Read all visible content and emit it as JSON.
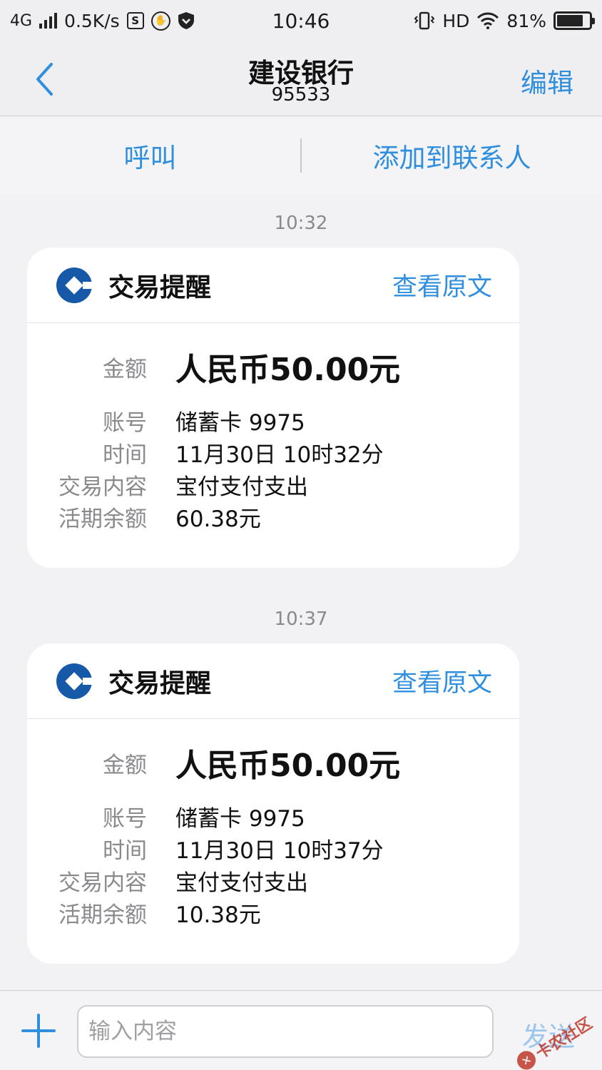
{
  "status_bar": {
    "network": "4G",
    "speed": "0.5K/s",
    "time": "10:46",
    "hd": "HD",
    "battery": "81%",
    "battery_level": 0.81,
    "icons": [
      "signal-icon",
      "s-box-icon",
      "hand-circle-icon",
      "shield-icon",
      "vibrate-icon",
      "wifi-icon",
      "battery-icon"
    ]
  },
  "header": {
    "title": "建设银行",
    "subtitle": "95533",
    "edit_label": "编辑",
    "back_icon": "chevron-left-icon"
  },
  "actions": {
    "call_label": "呼叫",
    "add_contact_label": "添加到联系人"
  },
  "messages": [
    {
      "time": "10:32",
      "title": "交易提醒",
      "view_label": "查看原文",
      "amount_label": "金额",
      "amount": "人民币50.00元",
      "fields": [
        {
          "label": "账号",
          "value": "储蓄卡 9975"
        },
        {
          "label": "时间",
          "value": "11月30日 10时32分"
        },
        {
          "label": "交易内容",
          "value": "宝付支付支出"
        },
        {
          "label": "活期余额",
          "value": "60.38元"
        }
      ]
    },
    {
      "time": "10:37",
      "title": "交易提醒",
      "view_label": "查看原文",
      "amount_label": "金额",
      "amount": "人民币50.00元",
      "fields": [
        {
          "label": "账号",
          "value": "储蓄卡 9975"
        },
        {
          "label": "时间",
          "value": "11月30日 10时37分"
        },
        {
          "label": "交易内容",
          "value": "宝付支付支出"
        },
        {
          "label": "活期余额",
          "value": "10.38元"
        }
      ]
    }
  ],
  "input": {
    "placeholder": "输入内容",
    "value": "",
    "send_label": "发送"
  },
  "watermark": {
    "text": "卡农社区"
  },
  "colors": {
    "accent": "#2f8fde",
    "bank_blue": "#1659a8",
    "send_disabled": "#9cc6ee"
  }
}
